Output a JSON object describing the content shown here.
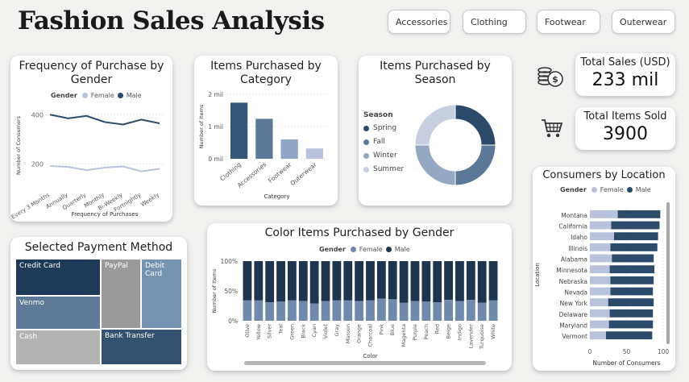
{
  "page": {
    "title": "Fashion Sales Analysis"
  },
  "filters": [
    "Accessories",
    "Clothing",
    "Footwear",
    "Outerwear"
  ],
  "colors": {
    "female": "#b8c3db",
    "male": "#2c4a69",
    "bar_dark": "#345677",
    "bar_mid": "#5c7898",
    "bar_light": "#8fa6c6",
    "bar_lighter": "#b8c3db"
  },
  "icons": {
    "sales": "money-coins-icon",
    "items": "shopping-cart-icon"
  },
  "freq_gender": {
    "title": "Frequency of Purchase by Gender",
    "legend_title": "Gender",
    "legend": [
      "Female",
      "Male"
    ],
    "chart_data": {
      "type": "line",
      "x": [
        "Every 3 Months",
        "Annually",
        "Quarterly",
        "Monthly",
        "Bi-Weekly",
        "Fortnightly",
        "Weekly"
      ],
      "series": [
        {
          "name": "Female",
          "values": [
            192,
            188,
            175,
            185,
            190,
            170,
            180
          ]
        },
        {
          "name": "Male",
          "values": [
            400,
            385,
            395,
            370,
            360,
            380,
            365
          ]
        }
      ],
      "xlabel": "Frequency of Purchases",
      "ylabel": "Number of Consumers",
      "yticks": [
        "200",
        "400"
      ],
      "ylim": [
        100,
        450
      ]
    }
  },
  "items_category": {
    "title": "Items Purchased by Category",
    "chart_data": {
      "type": "bar",
      "categories": [
        "Clothing",
        "Accessories",
        "Footwear",
        "Outerwear"
      ],
      "values": [
        1.74,
        1.24,
        0.6,
        0.32
      ],
      "yticks": [
        "0 mil",
        "1 mil",
        "2 mil"
      ],
      "ylim": [
        0,
        2
      ],
      "xlabel": "Category",
      "ylabel": "Number of Items"
    }
  },
  "items_season": {
    "title": "Items Purchased by Season",
    "legend_title": "Season",
    "chart_data": {
      "type": "pie",
      "labels": [
        "Spring",
        "Fall",
        "Winter",
        "Summer"
      ],
      "values": [
        25,
        25,
        25,
        25
      ],
      "colors": [
        "#2c4a69",
        "#5c7898",
        "#94a8c2",
        "#c6cee0"
      ]
    }
  },
  "kpi": {
    "sales_label": "Total Sales (USD)",
    "sales_value": "233 mil",
    "items_label": "Total Items Sold",
    "items_value": "3900"
  },
  "payment": {
    "title": "Selected Payment Method",
    "chart_data": {
      "type": "treemap",
      "labels": [
        "Credit Card",
        "Venmo",
        "Cash",
        "PayPal",
        "Debit Card",
        "Bank Transfer"
      ],
      "colors": [
        "#1f3a59",
        "#5e7a98",
        "#b3b3b3",
        "#9a9a9a",
        "#7693b2",
        "#34526f"
      ]
    }
  },
  "color_gender": {
    "title": "Color Items Purchased by Gender",
    "legend_title": "Gender",
    "legend": [
      "Female",
      "Male"
    ],
    "chart_data": {
      "type": "bar",
      "stacked": "100%",
      "categories": [
        "Olive",
        "Yellow",
        "Silver",
        "Teal",
        "Green",
        "Black",
        "Cyan",
        "Violet",
        "Gray",
        "Maroon",
        "Orange",
        "Charcoal",
        "Pink",
        "Blue",
        "Magenta",
        "Purple",
        "Peach",
        "Red",
        "Beige",
        "Indigo",
        "Lavender",
        "Turquoise",
        "White"
      ],
      "series": [
        {
          "name": "Female",
          "values": [
            34,
            34,
            31,
            32,
            34,
            33,
            29,
            33,
            34,
            34,
            33,
            34,
            37,
            36,
            30,
            33,
            32,
            31,
            35,
            33,
            35,
            30,
            34
          ]
        },
        {
          "name": "Male",
          "values": [
            66,
            66,
            69,
            68,
            66,
            67,
            71,
            67,
            66,
            66,
            67,
            66,
            63,
            64,
            70,
            67,
            68,
            69,
            65,
            67,
            65,
            70,
            66
          ]
        }
      ],
      "yticks": [
        "0%",
        "50%",
        "100%"
      ],
      "xlabel": "Color",
      "ylabel": "Number of Items"
    }
  },
  "location": {
    "title": "Consumers by Location",
    "legend_title": "Gender",
    "legend": [
      "Female",
      "Male"
    ],
    "chart_data": {
      "type": "bar",
      "orientation": "horizontal",
      "stacked": true,
      "categories": [
        "Montana",
        "California",
        "Idaho",
        "Illinois",
        "Alabama",
        "Minnesota",
        "Nebraska",
        "Nevada",
        "New York",
        "Delaware",
        "Maryland",
        "Vermont"
      ],
      "series": [
        {
          "name": "Female",
          "values": [
            38,
            29,
            33,
            28,
            30,
            27,
            28,
            28,
            25,
            27,
            26,
            22
          ]
        },
        {
          "name": "Male",
          "values": [
            58,
            66,
            60,
            64,
            57,
            61,
            59,
            58,
            62,
            59,
            60,
            63
          ]
        }
      ],
      "xticks": [
        "0",
        "50",
        "100"
      ],
      "xlim": [
        0,
        100
      ],
      "xlabel": "Number of Consumers",
      "ylabel": "Location"
    }
  }
}
